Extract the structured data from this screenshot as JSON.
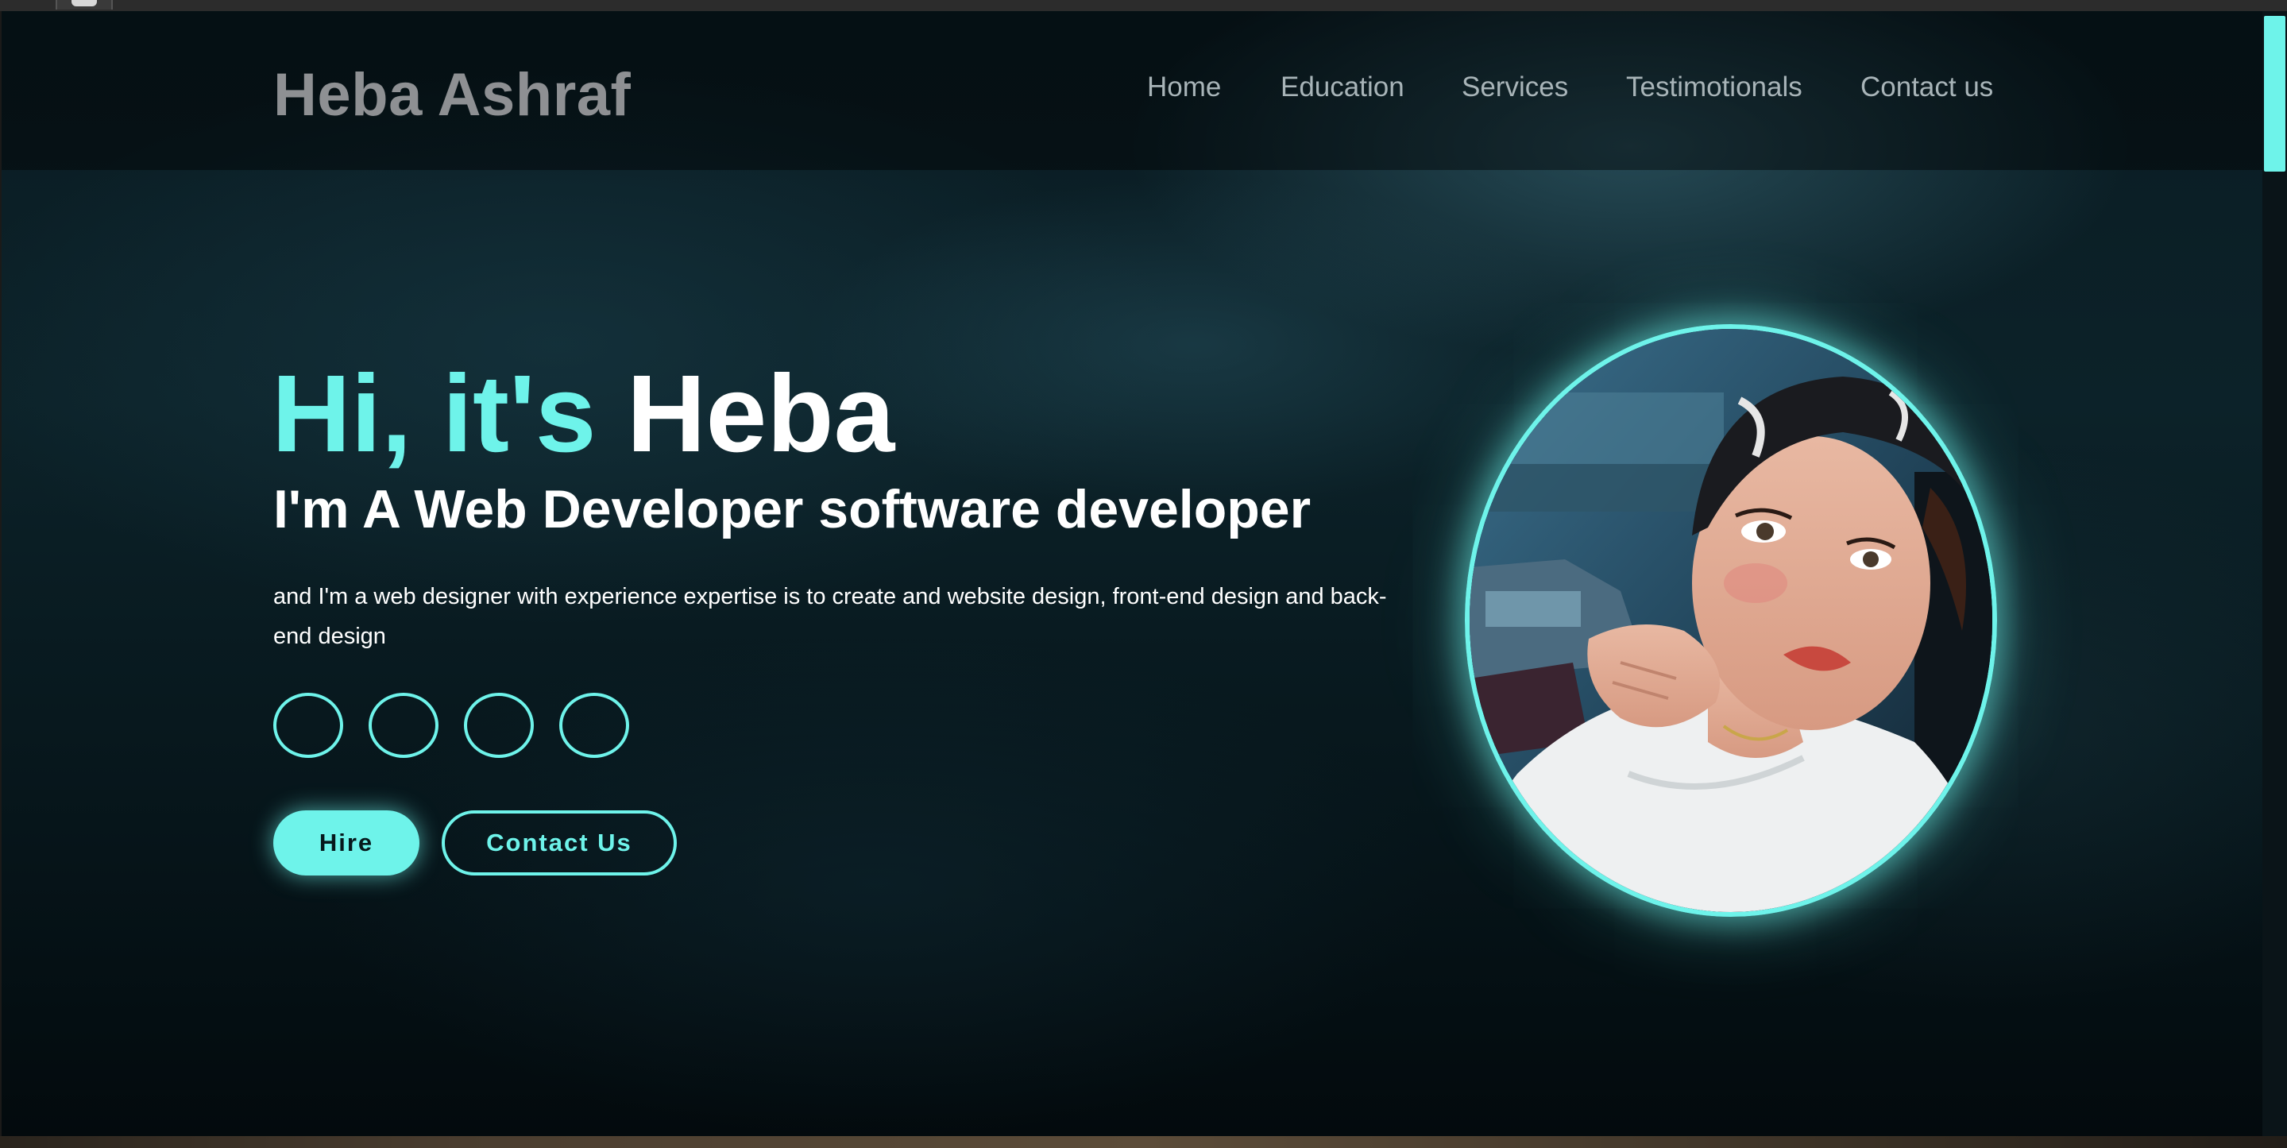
{
  "header": {
    "brand": "Heba Ashraf",
    "nav": [
      {
        "label": "Home"
      },
      {
        "label": "Education"
      },
      {
        "label": "Services"
      },
      {
        "label": "Testimotionals"
      },
      {
        "label": "Contact us"
      }
    ]
  },
  "hero": {
    "greeting_accent": "Hi, it's",
    "greeting_name": "Heba",
    "role": "I'm A Web Developer software developer",
    "description": "and I'm a web designer with experience expertise is to create and website design, front-end design and back-end design",
    "social_links": [
      {
        "icon": "social-icon-1"
      },
      {
        "icon": "social-icon-2"
      },
      {
        "icon": "social-icon-3"
      },
      {
        "icon": "social-icon-4"
      }
    ],
    "hire_label": "Hire",
    "contact_label": "Contact Us",
    "portrait": "profile-photo"
  },
  "colors": {
    "accent": "#6ef3ea",
    "brand_text": "#8e9093",
    "nav_text": "#a8b4b8",
    "heading_text": "#ffffff",
    "background": "#0a1c23"
  }
}
